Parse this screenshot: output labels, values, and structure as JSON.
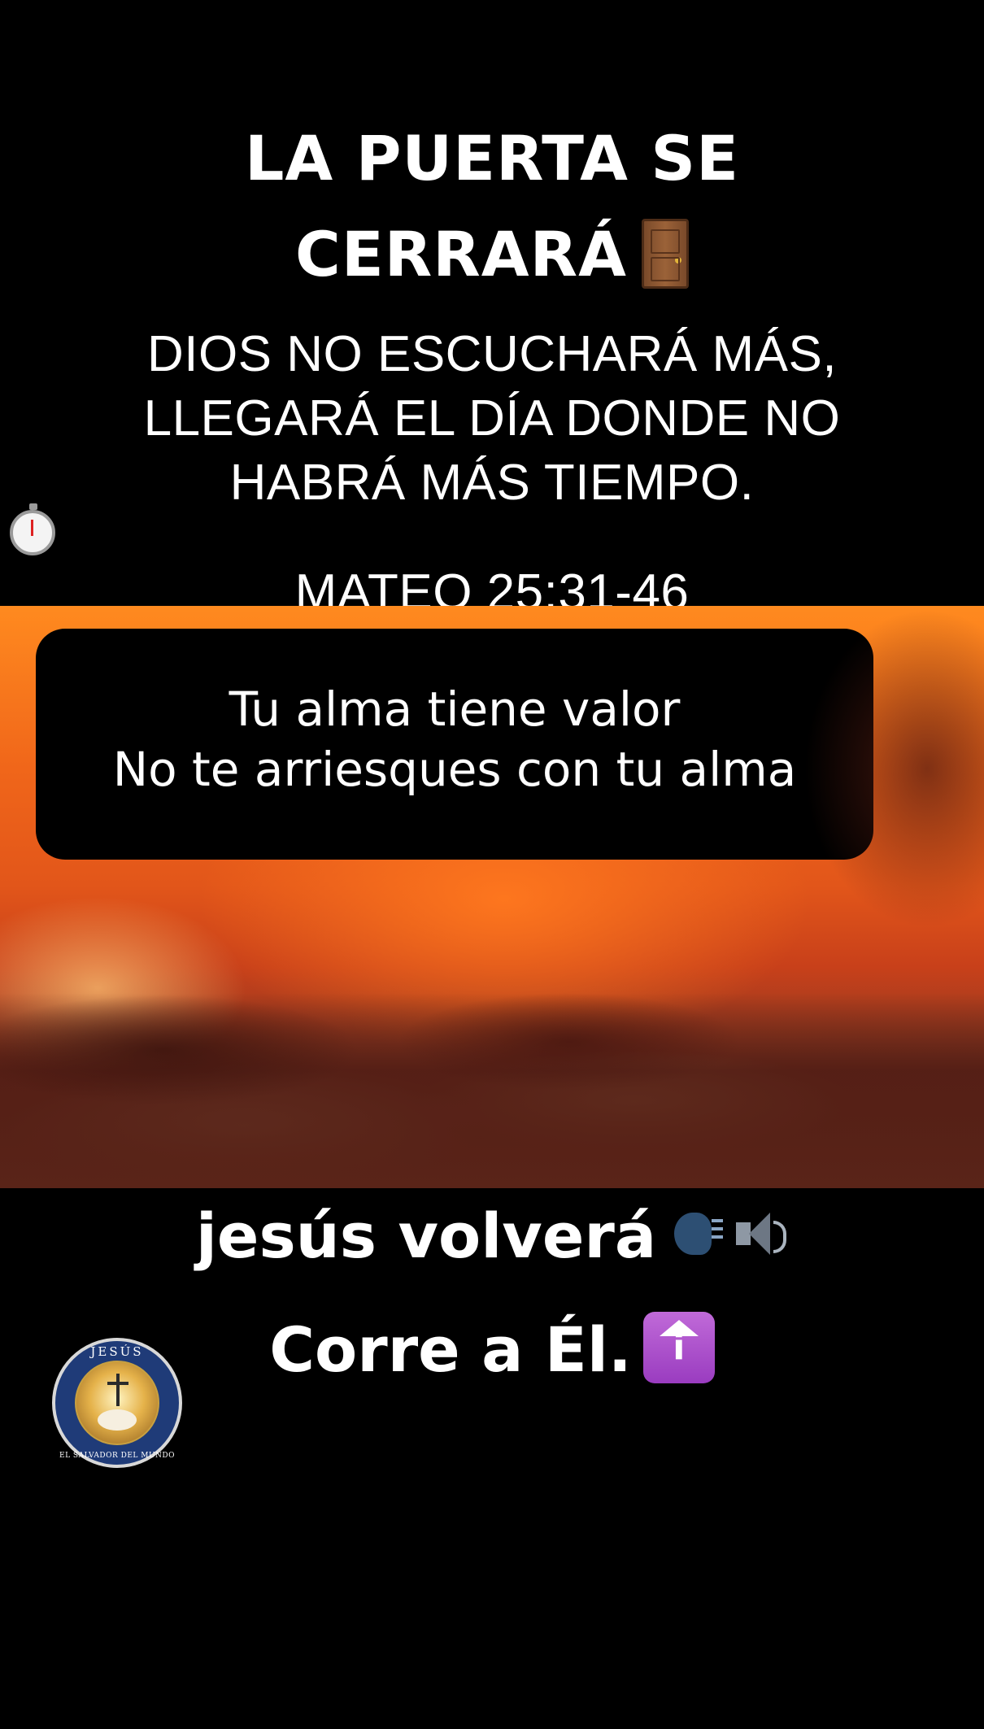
{
  "header": {
    "title_lines": [
      "LA PUERTA SE",
      "CERRARÁ"
    ],
    "title_icon": "door-icon",
    "subtitle_lines": [
      "DIOS NO ESCUCHARÁ MÁS,",
      "LLEGARÁ EL DÍA DONDE NO",
      "HABRÁ MÁS TIEMPO.",
      "MATEO 25:31-46"
    ],
    "subtitle_icons": [
      "stopwatch-icon",
      "open-book-icon"
    ]
  },
  "video": {
    "scene": "fire",
    "caption_lines": [
      "Tu alma tiene valor",
      "No te arriesques con tu alma"
    ]
  },
  "footer": {
    "line1": "jesús volverá",
    "line1_icons": [
      "speaking-head-icon",
      "speaker-icon"
    ],
    "line2": "Corre a Él.",
    "line2_icon": "information-symbol-icon",
    "info_symbol_label": "i"
  },
  "logo": {
    "top_text": "JESÚS",
    "bottom_text": "EL SALVADOR DEL MUNDO"
  },
  "colors": {
    "background": "#000000",
    "text": "#ffffff",
    "fire_orange": "#f0661a",
    "info_symbol_purple": "#9a3cc0"
  }
}
